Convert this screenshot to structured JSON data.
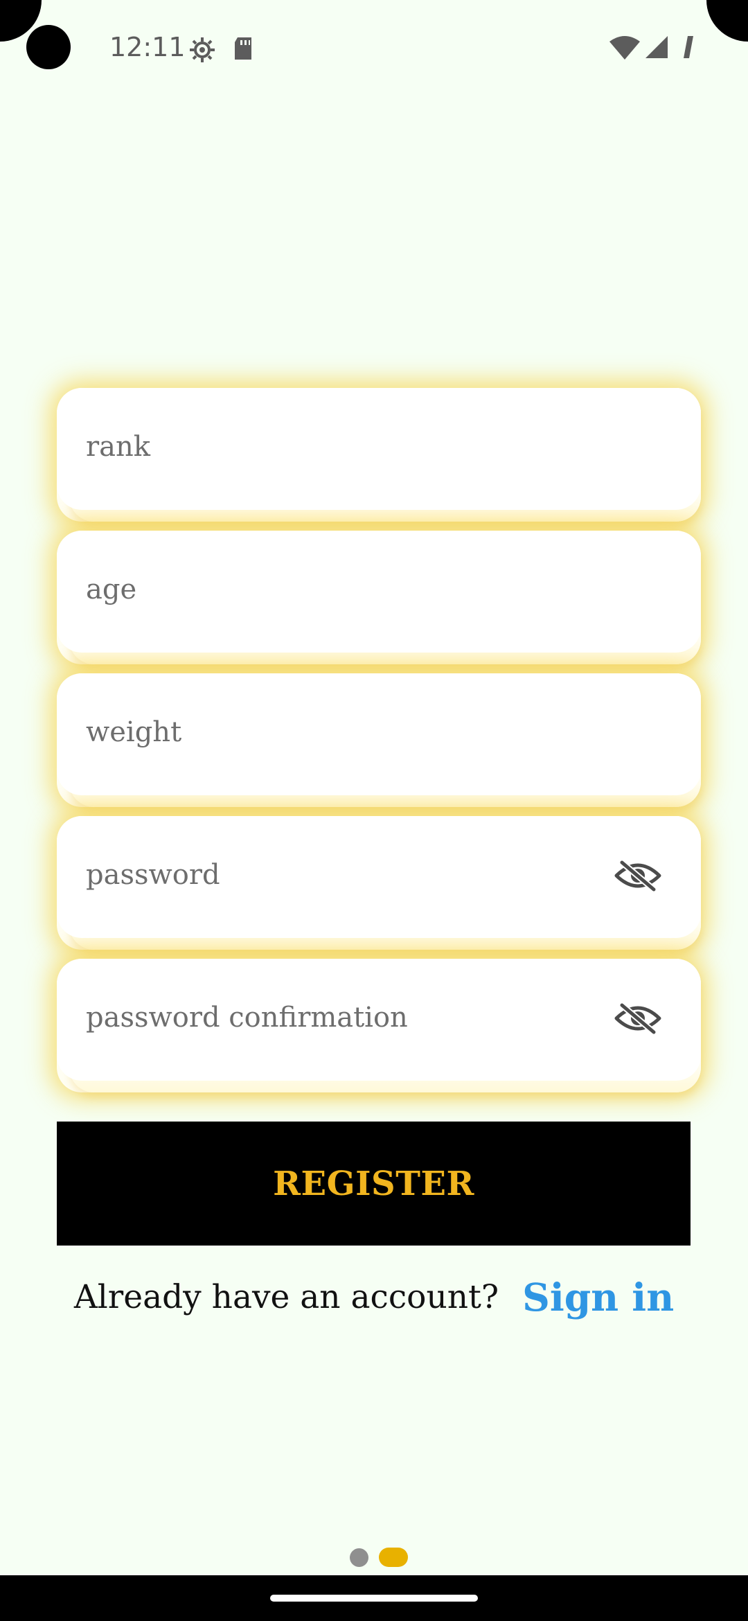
{
  "status_bar": {
    "time": "12:11",
    "icons": [
      "camera-cutout",
      "settings-icon",
      "sd-card-icon",
      "wifi-icon",
      "signal-icon",
      "battery-icon"
    ]
  },
  "form": {
    "fields": [
      {
        "placeholder": "rank",
        "has_visibility_toggle": false
      },
      {
        "placeholder": "age",
        "has_visibility_toggle": false
      },
      {
        "placeholder": "weight",
        "has_visibility_toggle": false
      },
      {
        "placeholder": "password",
        "has_visibility_toggle": true,
        "toggle_icon": "eye-off-icon"
      },
      {
        "placeholder": "password confirmation",
        "has_visibility_toggle": true,
        "toggle_icon": "eye-off-icon"
      }
    ]
  },
  "register_button": {
    "label": "REGISTER"
  },
  "signin": {
    "prompt": "Already have an account?",
    "link_label": "Sign in"
  },
  "page_indicator": {
    "total": 2,
    "active_index": 1
  },
  "colors": {
    "background": "#f6fff4",
    "field_glow": "#f7d34b",
    "button_background": "#000000",
    "button_text": "#f1b51f",
    "link": "#2f96e3",
    "active_indicator": "#e8b100"
  }
}
